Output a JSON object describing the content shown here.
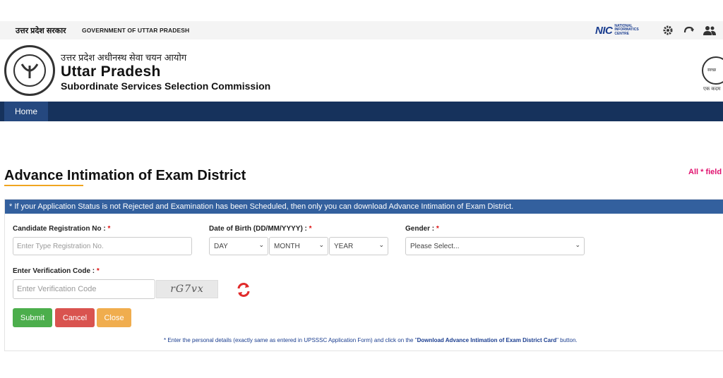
{
  "topbar": {
    "hindi_label": "उत्तर प्रदेश सरकार",
    "gov_label": "GOVERNMENT OF UTTAR PRADESH",
    "nic_logo": "NIC",
    "nic_line1": "NATIONAL",
    "nic_line2": "INFORMATICS",
    "nic_line3": "CENTRE",
    "icons": [
      "gear-icon",
      "accessibility-icon",
      "users-icon"
    ]
  },
  "header": {
    "hindi_title": "उत्तर प्रदेश अधीनस्थ सेवा चयन आयोग",
    "title": "Uttar Pradesh",
    "subtitle": "Subordinate Services Selection Commission",
    "swachh_line": "स्वच्छ",
    "swachh_caption": "एक कदम"
  },
  "nav": {
    "home_label": "Home"
  },
  "page": {
    "title": "Advance Intimation of Exam District",
    "required_note": "All * field"
  },
  "form": {
    "notice": "* If your Application Status is not Rejected and Examination has been Scheduled, then only you can download Advance Intimation of Exam District.",
    "reg_label": "Candidate Registration No :",
    "reg_placeholder": "Enter Type Registration No.",
    "dob_label": "Date of Birth (DD/MM/YYYY) :",
    "day_value": "DAY",
    "month_value": "MONTH",
    "year_value": "YEAR",
    "gender_label": "Gender :",
    "gender_value": "Please Select...",
    "verify_label": "Enter Verification Code :",
    "verify_placeholder": "Enter Verification Code",
    "captcha_text": "rG7vx",
    "required_mark": "*",
    "submit_label": "Submit",
    "cancel_label": "Cancel",
    "close_label": "Close",
    "footnote_pre": "* Enter the personal details (exactly same as entered in UPSSSC Application Form) and click on the \"",
    "footnote_bold": "Download Advance Intimation of Exam District Card",
    "footnote_post": "\" button."
  },
  "colors": {
    "nav_bg": "#16325c",
    "notice_bg": "#33609e",
    "submit": "#4cae4c",
    "cancel": "#d9534f",
    "close": "#f0ad4e",
    "accent_underline": "#f0a520",
    "required_note": "#e0116e"
  }
}
